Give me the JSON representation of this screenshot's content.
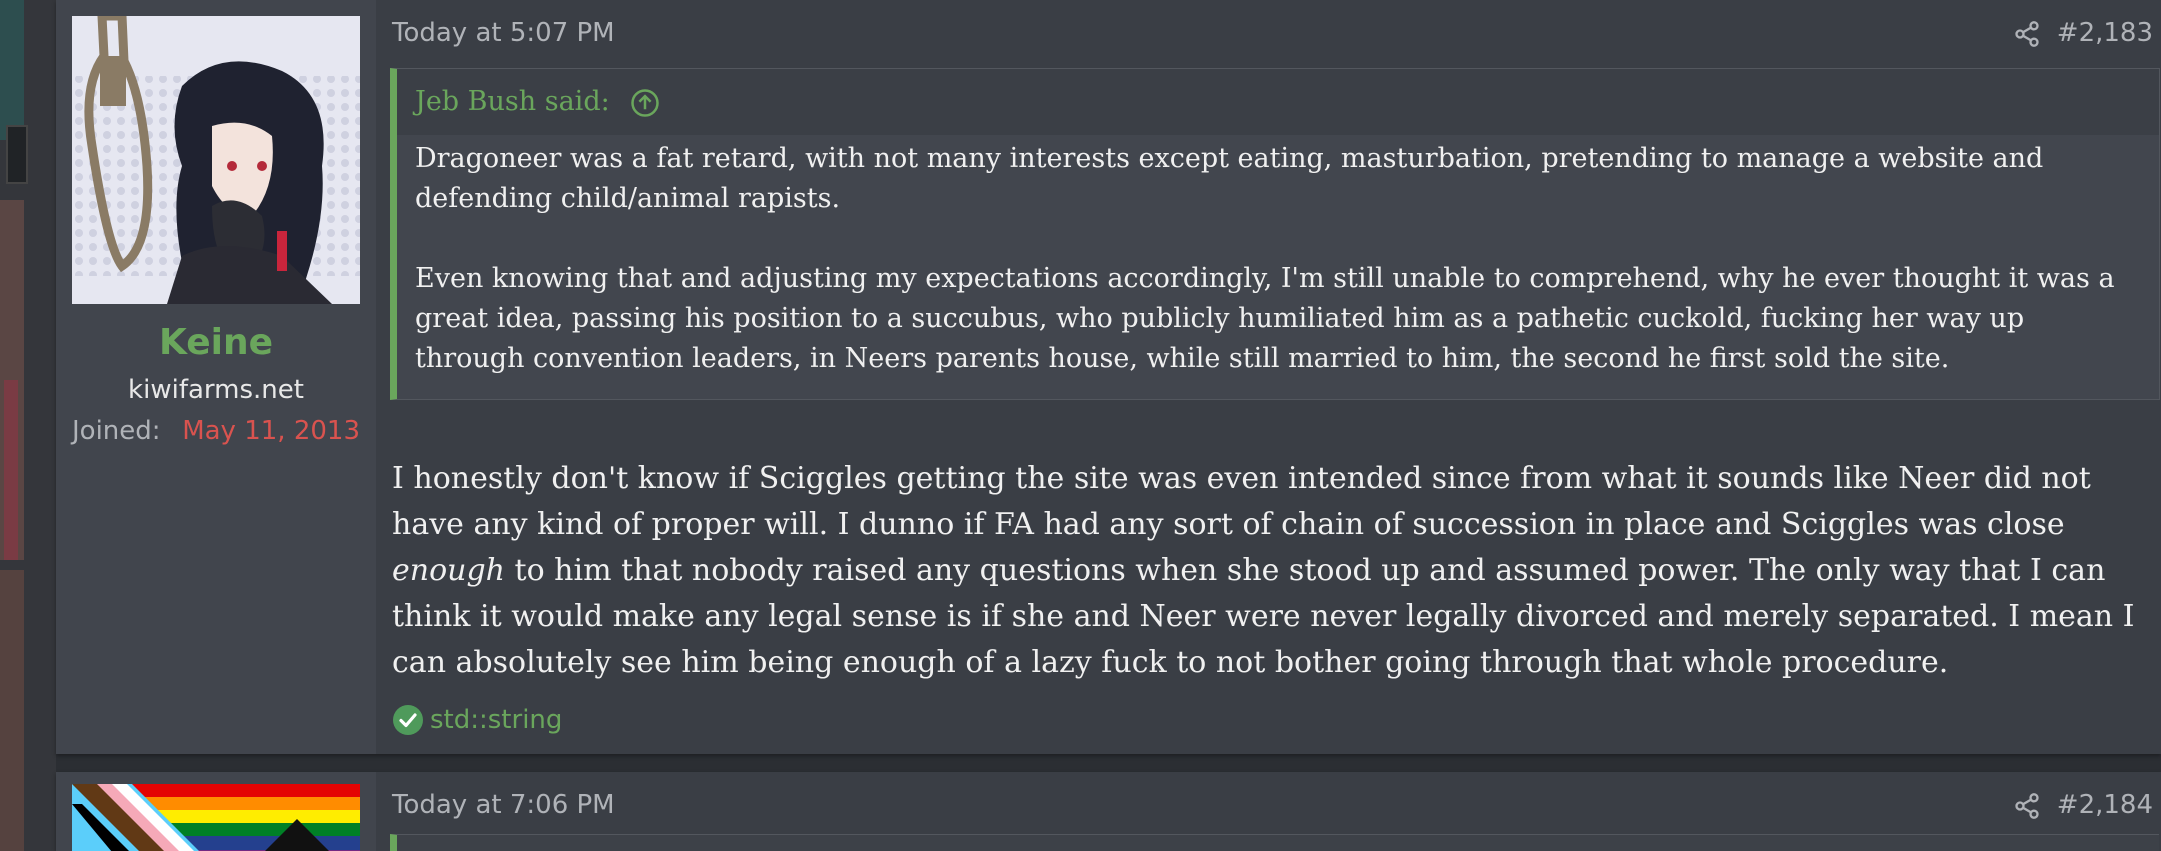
{
  "posts": [
    {
      "author": {
        "username": "Keine",
        "title": "kiwifarms.net",
        "joined_label": "Joined:",
        "joined_value": "May 11, 2013"
      },
      "date": "Today at 5:07 PM",
      "number": "#2,183",
      "quote": {
        "author_line": "Jeb Bush said:",
        "paragraphs": [
          "Dragoneer was a fat retard, with not many interests except eating, masturbation, pretending to manage a website and defending child/animal rapists.",
          "Even knowing that and adjusting my expectations accordingly, I'm still unable to comprehend, why he ever thought it was a great idea, passing his position to a succubus, who publicly humiliated him as a pathetic cuckold, fucking her way up through convention leaders, in Neers parents house, while still married to him, the second he first sold the site."
        ]
      },
      "body": {
        "before_emphasis": "I honestly don't know if Sciggles getting the site was even intended since from what it sounds like Neer did not have any kind of proper will. I dunno if FA had any sort of chain of succession in place and Sciggles was close ",
        "emphasis": "enough",
        "after_emphasis": " to him that nobody raised any questions when she stood up and assumed power. The only way that I can think it would make any legal sense is if she and Neer were never legally divorced and merely separated. I mean I can absolutely see him being enough of a lazy fuck to not bother going through that whole procedure."
      },
      "reaction": {
        "icon": "check-icon",
        "label": "std::string"
      }
    },
    {
      "date": "Today at 7:06 PM",
      "number": "#2,184"
    }
  ],
  "colors": {
    "accent_green": "#6aa65c",
    "joined_red": "#d9534f",
    "post_bg": "#3a3e45",
    "user_col_bg": "#41454d",
    "text": "#f0f0f0",
    "muted": "#b0b3b8"
  }
}
